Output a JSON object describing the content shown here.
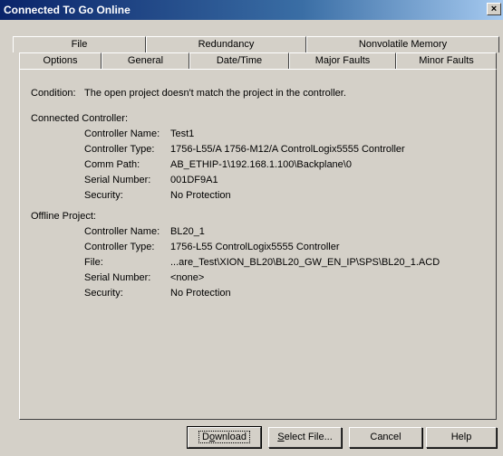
{
  "window": {
    "title": "Connected To Go Online",
    "close_glyph": "×"
  },
  "tabs_top": [
    "File",
    "Redundancy",
    "Nonvolatile Memory"
  ],
  "tabs_bottom": [
    "Options",
    "General",
    "Date/Time",
    "Major Faults",
    "Minor Faults"
  ],
  "condition": {
    "label": "Condition:",
    "text": "The open project doesn't match the project in the controller."
  },
  "connected": {
    "heading": "Connected Controller:",
    "fields": [
      {
        "label": "Controller Name:",
        "value": "Test1"
      },
      {
        "label": "Controller Type:",
        "value": "1756-L55/A 1756-M12/A ControlLogix5555 Controller"
      },
      {
        "label": "Comm Path:",
        "value": "AB_ETHIP-1\\192.168.1.100\\Backplane\\0"
      },
      {
        "label": "Serial Number:",
        "value": "001DF9A1"
      },
      {
        "label": "Security:",
        "value": "No Protection"
      }
    ]
  },
  "offline": {
    "heading": "Offline Project:",
    "fields": [
      {
        "label": "Controller Name:",
        "value": "BL20_1"
      },
      {
        "label": "Controller Type:",
        "value": "1756-L55 ControlLogix5555 Controller"
      },
      {
        "label": "File:",
        "value": "...are_Test\\XION_BL20\\BL20_GW_EN_IP\\SPS\\BL20_1.ACD"
      },
      {
        "label": "Serial Number:",
        "value": "<none>"
      },
      {
        "label": "Security:",
        "value": "No Protection"
      }
    ]
  },
  "buttons": {
    "download": {
      "accel": "o",
      "pre": "D",
      "post": "wnload"
    },
    "select_file": {
      "accel": "S",
      "pre": "",
      "post": "elect File..."
    },
    "cancel": "Cancel",
    "help": "Help"
  }
}
